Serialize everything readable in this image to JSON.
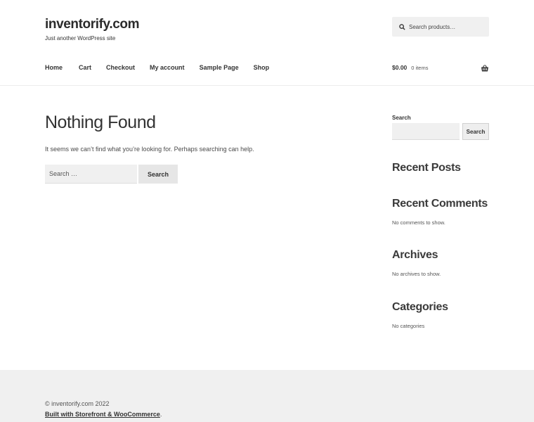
{
  "site": {
    "title": "inventorify.com",
    "description": "Just another WordPress site"
  },
  "header_search": {
    "placeholder": "Search products…",
    "icon": "search-icon"
  },
  "nav": {
    "items": [
      "Home",
      "Cart",
      "Checkout",
      "My account",
      "Sample Page",
      "Shop"
    ]
  },
  "cart": {
    "amount": "$0.00",
    "count": "0 items",
    "icon": "basket-icon"
  },
  "main": {
    "title": "Nothing Found",
    "message": "It seems we can’t find what you’re looking for. Perhaps searching can help.",
    "search_placeholder": "Search …",
    "search_button": "Search"
  },
  "sidebar": {
    "search_label": "Search",
    "search_button": "Search",
    "recent_posts": "Recent Posts",
    "recent_comments": "Recent Comments",
    "no_comments": "No comments to show.",
    "archives": "Archives",
    "no_archives": "No archives to show.",
    "categories": "Categories",
    "no_categories": "No categories"
  },
  "footer": {
    "copyright": "© inventorify.com 2022",
    "built_with": "Built with Storefront & WooCommerce",
    "built_suffix": "."
  },
  "colors": {
    "background": "#ffffff",
    "footer_bg": "#f0f0f0",
    "input_bg": "#f0f0f0",
    "text": "#333333"
  }
}
